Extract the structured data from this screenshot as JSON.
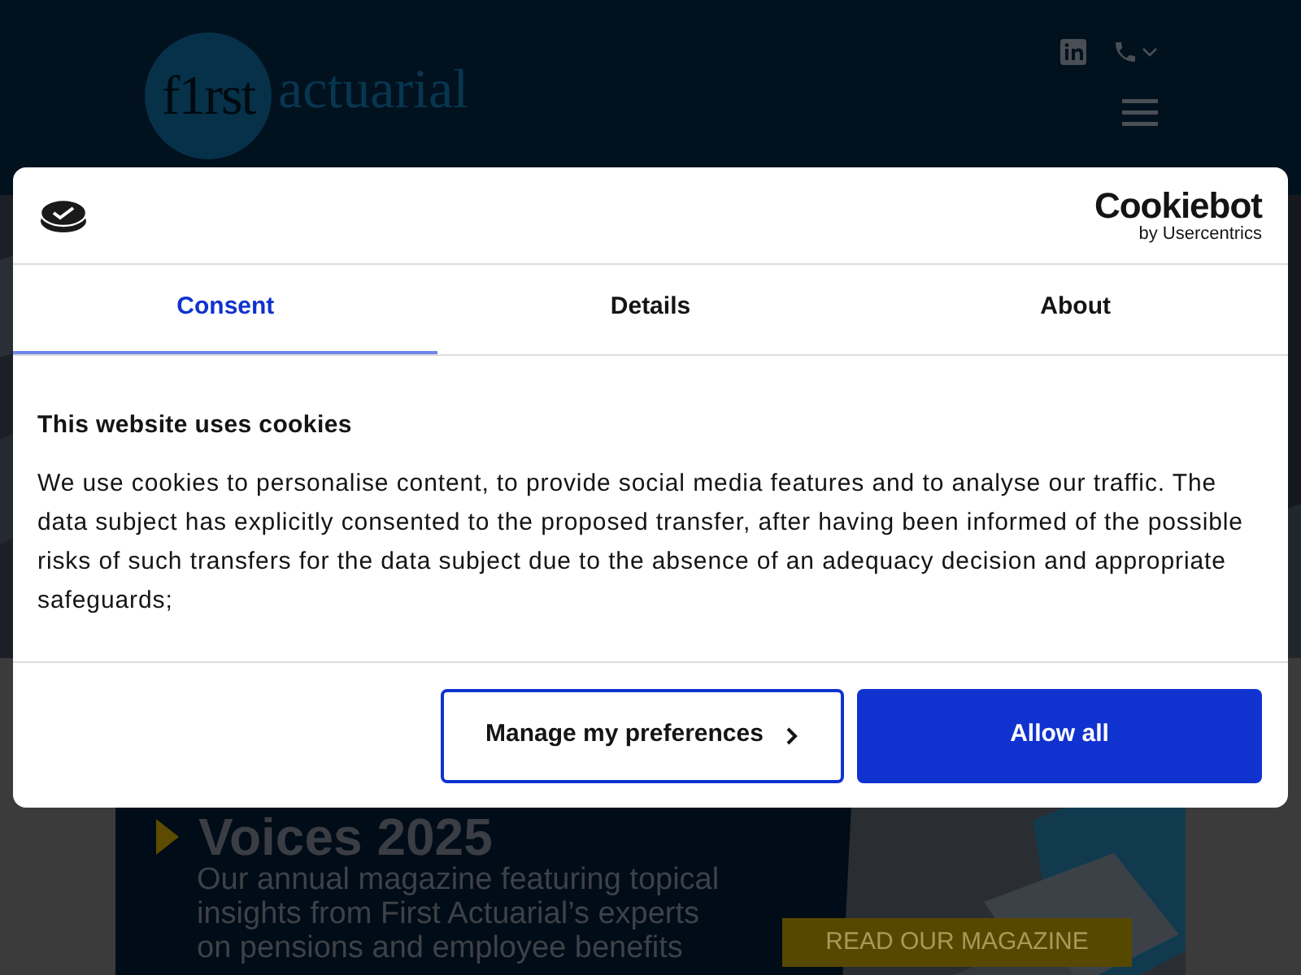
{
  "header": {
    "logo": {
      "first": "f1rst",
      "second": "actuarial"
    }
  },
  "feature": {
    "title": "Voices 2025",
    "lines": [
      "Our annual magazine featuring topical",
      "insights from First Actuarial’s experts",
      "on pensions and employee benefits"
    ],
    "button": "READ OUR MAGAZINE"
  },
  "dialog": {
    "brand": {
      "name": "Cookiebot",
      "byline": "by Usercentrics"
    },
    "tabs": [
      {
        "label": "Consent",
        "selected": true
      },
      {
        "label": "Details",
        "selected": false
      },
      {
        "label": "About",
        "selected": false
      }
    ],
    "heading": "This website uses cookies",
    "text": "We use cookies to personalise content, to provide social media features and to analyse our traffic. The data subject has explicitly consented to the proposed transfer, after having been informed of the possible risks of such transfers for the data subject due to the absence of an adequacy decision and appropriate safeguards;",
    "buttons": [
      {
        "kind": "outline",
        "label": "Manage my preferences"
      },
      {
        "kind": "primary",
        "label": "Allow all"
      }
    ]
  }
}
